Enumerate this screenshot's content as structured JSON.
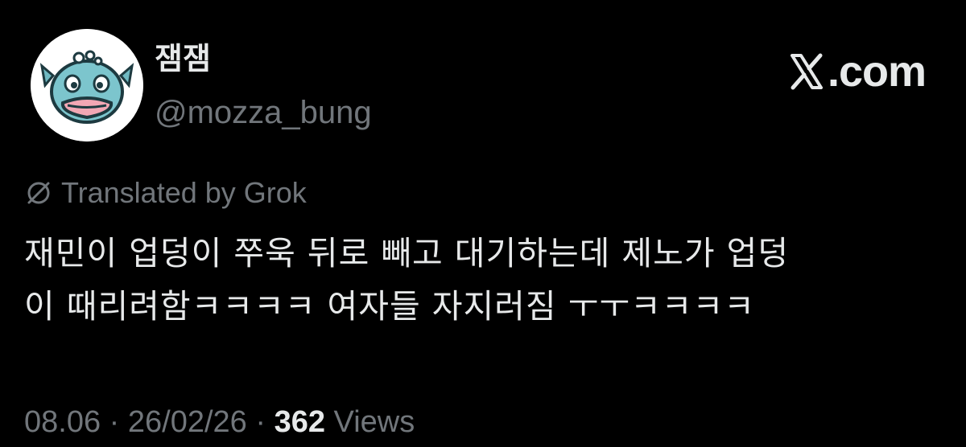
{
  "user": {
    "display_name": "잼잼",
    "handle": "@mozza_bung"
  },
  "brand": {
    "name": "X.com",
    "text": ".com",
    "logo_icon": "x-logo-icon"
  },
  "translation": {
    "label": "Translated by Grok",
    "icon": "globe-slash-icon"
  },
  "tweet": {
    "line1": "재민이 업덩이 쭈욱 뒤로 빼고 대기하는데 제노가 업덩",
    "line2": "이 때리려함ㅋㅋㅋㅋ 여자들 자지러짐 ㅜㅜㅋㅋㅋㅋ"
  },
  "meta": {
    "time": "08.06",
    "date": "26/02/26",
    "sep": "·",
    "views_count": "362",
    "views_label": "Views"
  },
  "colors": {
    "background": "#000000",
    "text_primary": "#e7e9ea",
    "text_secondary": "#71767b"
  }
}
